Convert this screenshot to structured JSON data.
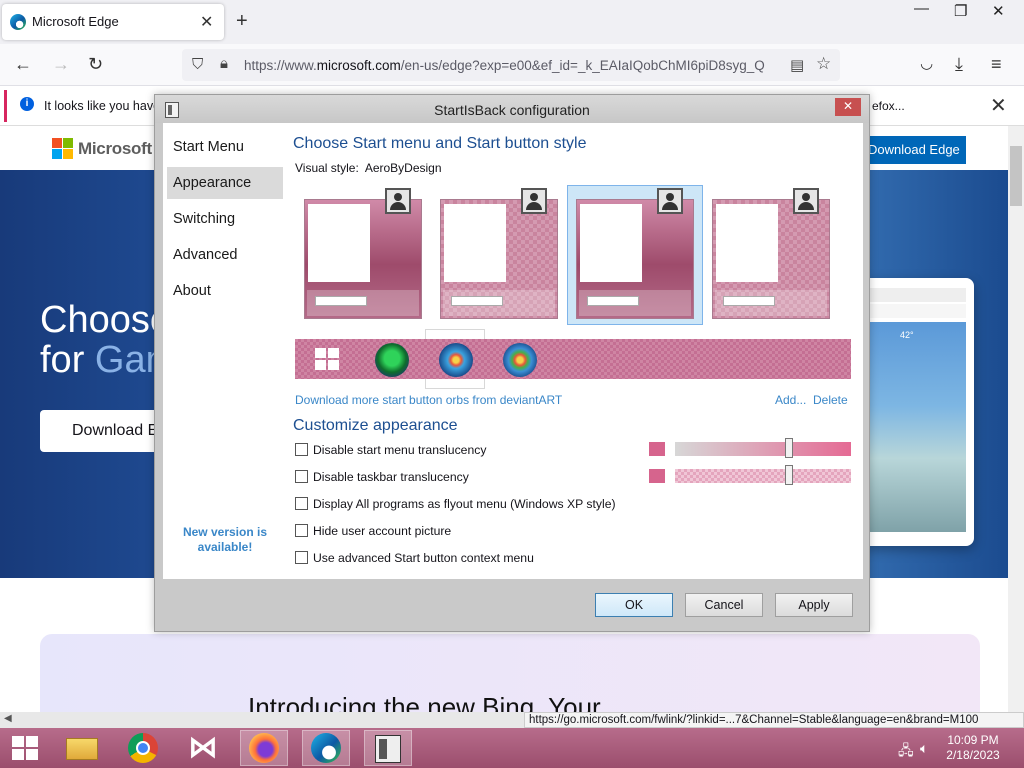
{
  "browser": {
    "tab_title": "Microsoft Edge",
    "url_prefix": "https://www.",
    "url_domain": "microsoft.com",
    "url_rest": "/en-us/edge?exp=e00&ef_id=_k_EAIaIQobChMI6piD8syg_Q",
    "notification_text": "It looks like you have",
    "notification_text_right": "efox...",
    "status_url": "https://go.microsoft.com/fwlink/?linkid=...7&Channel=Stable&language=en&brand=M100"
  },
  "page": {
    "brand": "Microsoft",
    "download_edge": "Download Edge",
    "hero_line1": "Choose",
    "hero_line2_a": "for ",
    "hero_line2_b": "Gam",
    "hero_button": "Download E",
    "bing_heading": "Introducing the new Bing. Your",
    "mock_temp": "42°"
  },
  "dialog": {
    "title": "StartIsBack configuration",
    "sidebar": [
      {
        "label": "Start Menu"
      },
      {
        "label": "Appearance"
      },
      {
        "label": "Switching"
      },
      {
        "label": "Advanced"
      },
      {
        "label": "About"
      }
    ],
    "selected_sidebar": "Appearance",
    "new_version": "New version is available!",
    "section1_heading": "Choose Start menu and Start button style",
    "visual_style_label": "Visual style:",
    "visual_style_value": "AeroByDesign",
    "download_orbs_link": "Download more start button orbs from deviantART",
    "add_link": "Add...",
    "delete_link": "Delete",
    "section2_heading": "Customize appearance",
    "options": [
      {
        "label": "Disable start menu translucency",
        "checked": false
      },
      {
        "label": "Disable taskbar translucency",
        "checked": false
      },
      {
        "label": "Display All programs as flyout menu (Windows XP style)",
        "checked": false
      },
      {
        "label": "Hide user account picture",
        "checked": false
      },
      {
        "label": "Use advanced Start button context menu",
        "checked": false
      }
    ],
    "ok": "OK",
    "cancel": "Cancel",
    "apply": "Apply"
  },
  "taskbar": {
    "time": "10:09 PM",
    "date": "2/18/2023"
  },
  "colors": {
    "accent_pink": "#c46f93",
    "dialog_heading": "#1d4f91",
    "link_blue": "#3a87c8",
    "edge_blue": "#0067b8"
  }
}
